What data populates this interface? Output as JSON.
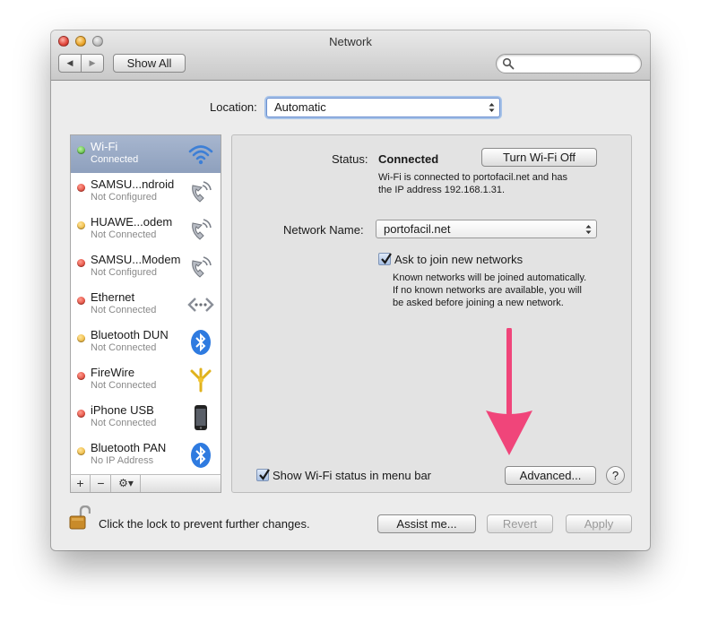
{
  "window": {
    "title": "Network"
  },
  "toolbar": {
    "show_all_label": "Show All",
    "back_glyph": "◀",
    "forward_glyph": "▶",
    "search_placeholder": ""
  },
  "location": {
    "label": "Location:",
    "value": "Automatic"
  },
  "services": [
    {
      "name": "Wi-Fi",
      "status": "Connected",
      "dot": "green",
      "icon": "wifi-icon",
      "selected": true
    },
    {
      "name": "SAMSU...ndroid",
      "status": "Not Configured",
      "dot": "red",
      "icon": "phone-modem-icon"
    },
    {
      "name": "HUAWE...odem",
      "status": "Not Connected",
      "dot": "yellow",
      "icon": "phone-modem-icon"
    },
    {
      "name": "SAMSU...Modem",
      "status": "Not Configured",
      "dot": "red",
      "icon": "phone-modem-icon"
    },
    {
      "name": "Ethernet",
      "status": "Not Connected",
      "dot": "red",
      "icon": "ethernet-icon"
    },
    {
      "name": "Bluetooth DUN",
      "status": "Not Connected",
      "dot": "yellow",
      "icon": "bluetooth-icon"
    },
    {
      "name": "FireWire",
      "status": "Not Connected",
      "dot": "red",
      "icon": "firewire-icon"
    },
    {
      "name": "iPhone USB",
      "status": "Not Connected",
      "dot": "red",
      "icon": "iphone-icon"
    },
    {
      "name": "Bluetooth PAN",
      "status": "No IP Address",
      "dot": "yellow",
      "icon": "bluetooth-icon"
    }
  ],
  "sidebar_bar": {
    "add": "+",
    "remove": "−",
    "gear": "⚙▾"
  },
  "detail": {
    "status_label": "Status:",
    "status_value": "Connected",
    "turn_off_label": "Turn Wi-Fi Off",
    "status_desc_1": "Wi-Fi is connected to portofacil.net and has",
    "status_desc_2": "the IP address 192.168.1.31.",
    "network_name_label": "Network Name:",
    "network_name_value": "portofacil.net",
    "ask_join_label": "Ask to join new networks",
    "ask_join_checked": true,
    "ask_desc_1": "Known networks will be joined automatically.",
    "ask_desc_2": "If no known networks are available, you will",
    "ask_desc_3": "be asked before joining a new network.",
    "show_status_label": "Show Wi-Fi status in menu bar",
    "show_status_checked": true,
    "advanced_label": "Advanced...",
    "help_label": "?"
  },
  "footer": {
    "lock_text": "Click the lock to prevent further changes.",
    "assist_label": "Assist me...",
    "revert_label": "Revert",
    "apply_label": "Apply"
  },
  "colors": {
    "annotation_arrow": "#f0457a",
    "selection": "#94a6c2"
  }
}
